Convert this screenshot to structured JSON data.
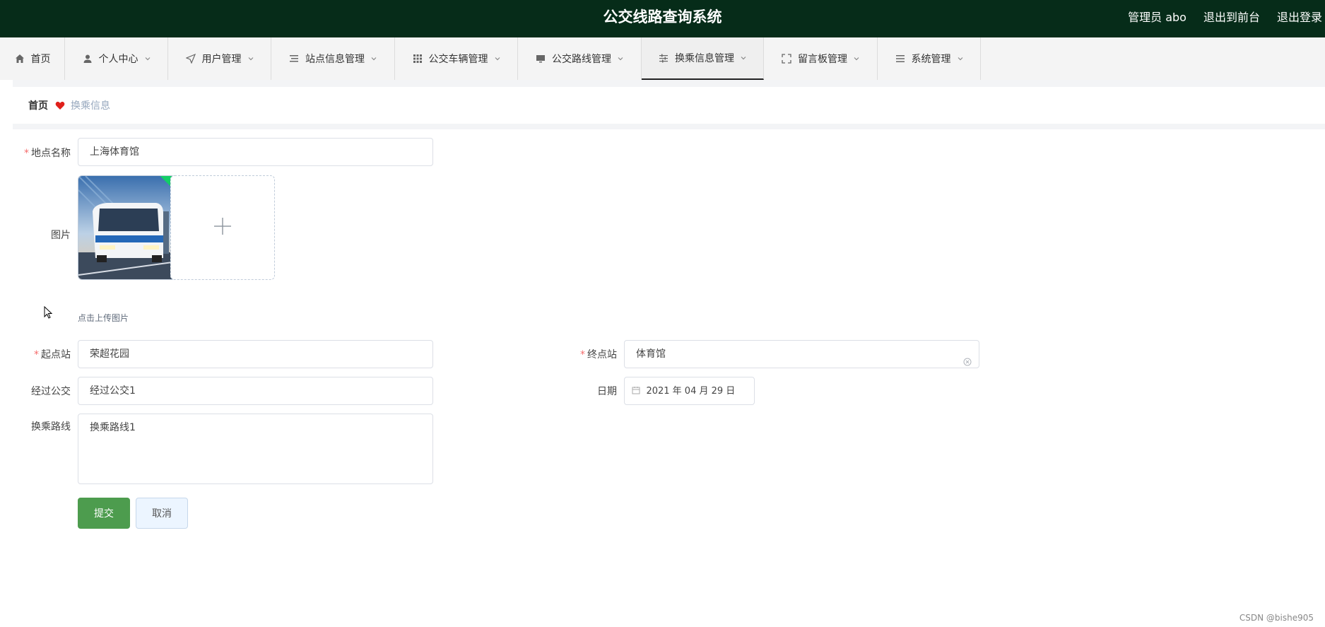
{
  "header": {
    "title": "公交线路查询系统",
    "admin_label": "管理员 abo",
    "to_front": "退出到前台",
    "logout": "退出登录"
  },
  "nav": {
    "items": [
      {
        "label": "首页",
        "icon": "home-icon"
      },
      {
        "label": "个人中心",
        "icon": "user-icon"
      },
      {
        "label": "用户管理",
        "icon": "send-icon"
      },
      {
        "label": "站点信息管理",
        "icon": "list-icon"
      },
      {
        "label": "公交车辆管理",
        "icon": "grid-icon"
      },
      {
        "label": "公交路线管理",
        "icon": "monitor-icon"
      },
      {
        "label": "换乘信息管理",
        "icon": "sliders-icon"
      },
      {
        "label": "留言板管理",
        "icon": "fullscreen-icon"
      },
      {
        "label": "系统管理",
        "icon": "menu-icon"
      }
    ],
    "active_label": "换乘信息管理"
  },
  "breadcrumb": {
    "home": "首页",
    "current": "换乘信息"
  },
  "form": {
    "place_name_label": "地点名称",
    "place_name_value": "上海体育馆",
    "image_label": "图片",
    "upload_tip": "点击上传图片",
    "start_label": "起点站",
    "start_value": "荣超花园",
    "end_label": "终点站",
    "end_value": "体育馆",
    "via_label": "经过公交",
    "via_value": "经过公交1",
    "date_label": "日期",
    "date_value": "2021 年 04 月 29 日",
    "route_label": "换乘路线",
    "route_value": "换乘路线1",
    "submit": "提交",
    "cancel": "取消"
  },
  "watermark": "CSDN @bishe905",
  "colors": {
    "header_bg": "#062c19",
    "primary_button": "#4d9c4e",
    "required_star": "#f56c6c",
    "heart": "#e0201b"
  }
}
